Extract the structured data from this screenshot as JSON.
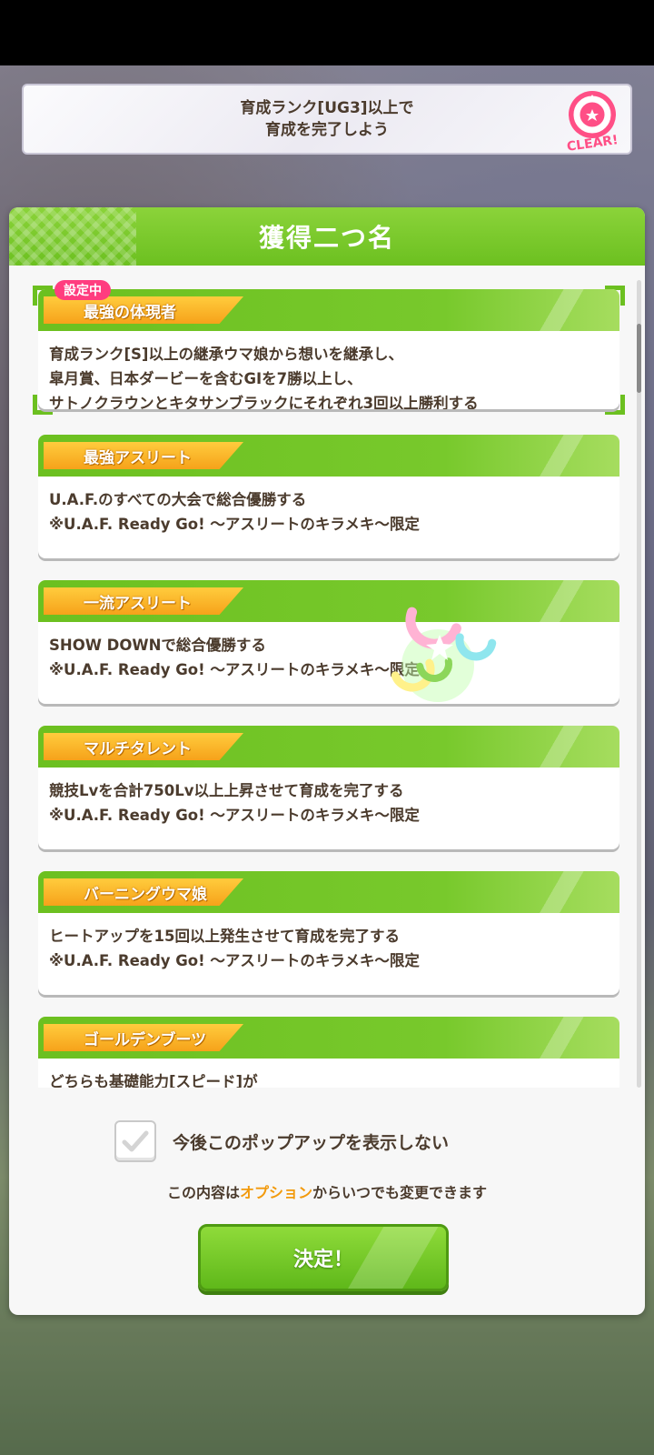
{
  "mission": {
    "line1": "育成ランク[UG3]以上で",
    "line2": "育成を完了しよう",
    "badge": "CLEAR!"
  },
  "modal": {
    "title": "獲得二つ名"
  },
  "selected_badge": "設定中",
  "cards": [
    {
      "title": "最強の体現者",
      "lines": [
        "育成ランク[S]以上の継承ウマ娘から想いを継承し、",
        "皐月賞、日本ダービーを含むGⅠを7勝以上し、",
        "サトノクラウンとキタサンブラックにそれぞれ3回以上勝利する"
      ]
    },
    {
      "title": "最強アスリート",
      "lines": [
        "U.A.F.のすべての大会で総合優勝する",
        "※U.A.F. Ready Go! ～アスリートのキラメキ～限定"
      ]
    },
    {
      "title": "一流アスリート",
      "lines": [
        "SHOW DOWNで総合優勝する",
        "※U.A.F. Ready Go! ～アスリートのキラメキ～限定"
      ]
    },
    {
      "title": "マルチタレント",
      "lines": [
        "競技Lvを合計750Lv以上上昇させて育成を完了する",
        "※U.A.F. Ready Go! ～アスリートのキラメキ～限定"
      ]
    },
    {
      "title": "バーニングウマ娘",
      "lines": [
        "ヒートアップを15回以上発生させて育成を完了する",
        "※U.A.F. Ready Go! ～アスリートのキラメキ～限定"
      ]
    },
    {
      "title": "ゴールデンブーツ",
      "lines": [
        "どちらも基礎能力[スピード]が"
      ]
    }
  ],
  "footer": {
    "checkbox_label": "今後このポップアップを表示しない",
    "note_before": "この内容は",
    "note_highlight": "オプション",
    "note_after": "からいつでも変更できます",
    "decide_button": "決定！"
  },
  "colors": {
    "accent_green": "#6cc020",
    "ribbon_orange": "#f6a21a",
    "badge_pink": "#ff3d7f",
    "text_brown": "#4b3b2d",
    "highlight_orange": "#f29a0d"
  }
}
